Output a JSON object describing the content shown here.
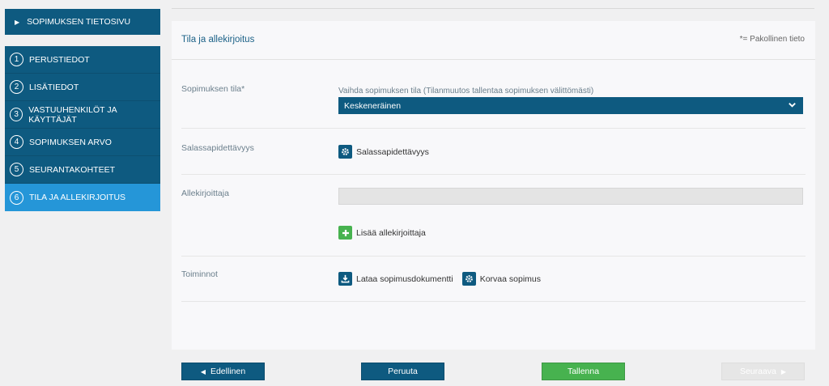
{
  "sidebar": {
    "top_link": "SOPIMUKSEN TIETOSIVU",
    "steps": [
      {
        "num": "1",
        "label": "PERUSTIEDOT"
      },
      {
        "num": "2",
        "label": "LISÄTIEDOT"
      },
      {
        "num": "3",
        "label": "VASTUUHENKILÖT JA KÄYTTÄJÄT"
      },
      {
        "num": "4",
        "label": "SOPIMUKSEN ARVO"
      },
      {
        "num": "5",
        "label": "SEURANTAKOHTEET"
      },
      {
        "num": "6",
        "label": "TILA JA ALLEKIRJOITUS"
      }
    ]
  },
  "panel": {
    "title": "Tila ja allekirjoitus",
    "required_note": "*= Pakollinen tieto",
    "status": {
      "label": "Sopimuksen tila*",
      "help": "Vaihda sopimuksen tila (Tilanmuutos tallentaa sopimuksen välittömästi)",
      "value": "Keskeneräinen"
    },
    "confidentiality": {
      "label": "Salassapidettävyys",
      "button": "Salassapidettävyys"
    },
    "signer": {
      "label": "Allekirjoittaja",
      "value": "",
      "add_button": "Lisää allekirjoittaja"
    },
    "actions": {
      "label": "Toiminnot",
      "download": "Lataa sopimusdokumentti",
      "replace": "Korvaa sopimus"
    }
  },
  "footer": {
    "previous": "Edellinen",
    "cancel": "Peruuta",
    "save": "Tallenna",
    "next": "Seuraava"
  },
  "colors": {
    "primary": "#0e5a80",
    "active": "#2596d8",
    "success": "#47b24f"
  }
}
